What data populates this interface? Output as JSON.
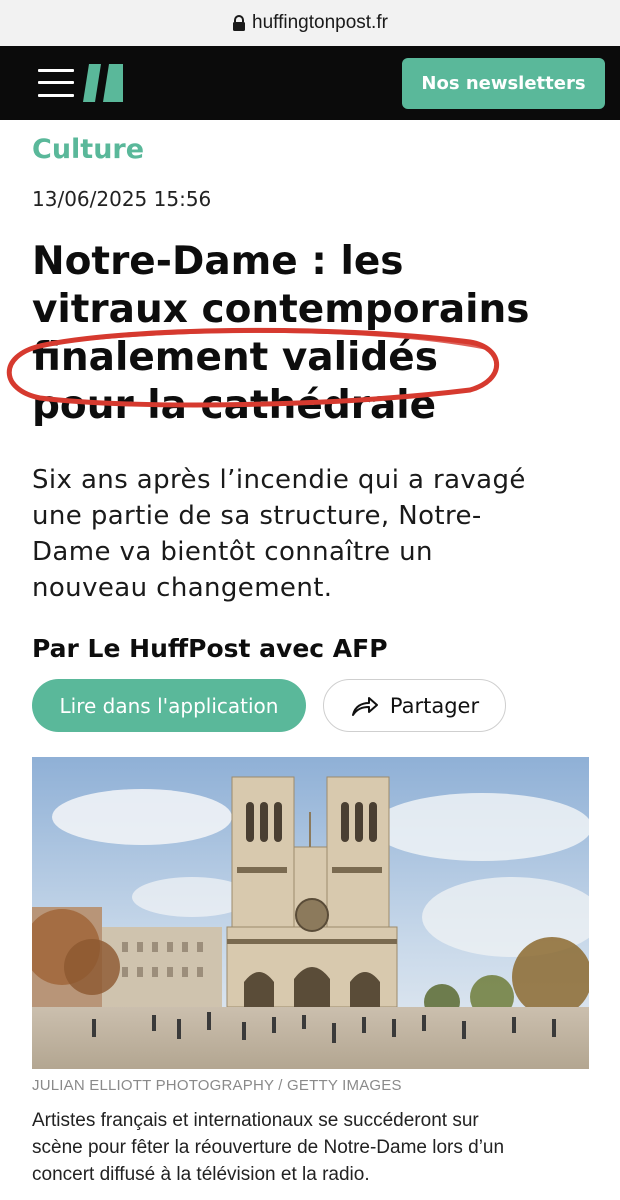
{
  "browser": {
    "url": "huffingtonpost.fr",
    "lock_icon": "lock-icon"
  },
  "header": {
    "menu_icon": "hamburger-menu-icon",
    "logo_icon": "huffpost-logo-icon",
    "newsletter_label": "Nos newsletters"
  },
  "article": {
    "category": "Culture",
    "date": "13/06/2025 15:56",
    "headline_lines": [
      "Notre-Dame : les",
      "vitraux contemporains",
      "finalement validés",
      "pour la cathédrale"
    ],
    "subhead_lines": [
      "Six ans après l’incendie qui a ravagé",
      "une partie de sa structure, Notre-",
      "Dame va bientôt connaître un",
      "nouveau changement."
    ],
    "byline": "Par Le HuffPost avec AFP",
    "read_in_app_label": "Lire dans l'application",
    "share_label": "Partager",
    "share_icon": "share-arrow-icon",
    "photo_credit": "JULIAN ELLIOTT PHOTOGRAPHY / GETTY IMAGES",
    "caption_lines": [
      "Artistes français et internationaux se succéderont sur",
      "scène pour fêter la réouverture de Notre-Dame lors d’un",
      "concert diffusé à la télévision et la radio."
    ]
  },
  "colors": {
    "accent": "#5ab89a",
    "header_bg": "#0b0b0b",
    "annotation": "#d63a2f"
  }
}
